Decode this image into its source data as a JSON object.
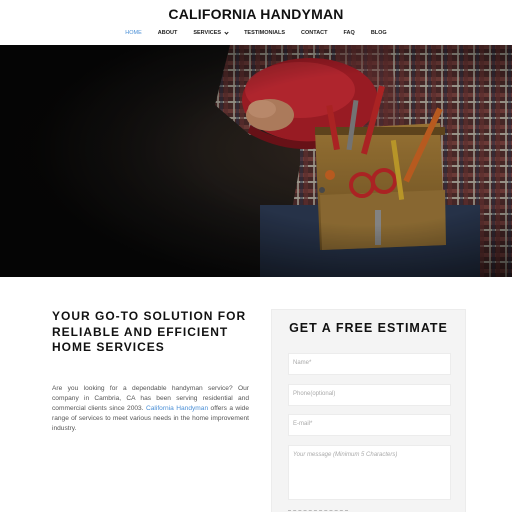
{
  "header": {
    "title": "CALIFORNIA HANDYMAN",
    "nav": [
      {
        "label": "HOME",
        "active": true
      },
      {
        "label": "ABOUT"
      },
      {
        "label": "SERVICES",
        "has_dropdown": true
      },
      {
        "label": "TESTIMONIALS"
      },
      {
        "label": "CONTACT"
      },
      {
        "label": "FAQ"
      },
      {
        "label": "BLOG"
      }
    ]
  },
  "hero": {
    "image": "handyman-tool-belt-photo"
  },
  "main": {
    "headline": "YOUR GO-TO SOLUTION FOR RELIABLE AND EFFICIENT HOME SERVICES",
    "intro_before": "Are you looking for a dependable handyman service? Our company in Cambria, CA has been serving residential and commercial clients since 2003. ",
    "intro_link": "California Handyman",
    "intro_after": " offers a wide range of services to meet various needs in the home improvement industry."
  },
  "estimate_form": {
    "title": "GET A FREE ESTIMATE",
    "name_placeholder": "Name*",
    "phone_placeholder": "Phone(optional)",
    "email_placeholder": "E-mail*",
    "message_placeholder": "Your message (Minimum 5 Characters)"
  },
  "colors": {
    "accent": "#4a8fd6",
    "text": "#111111",
    "hero_dark": "#161412"
  }
}
